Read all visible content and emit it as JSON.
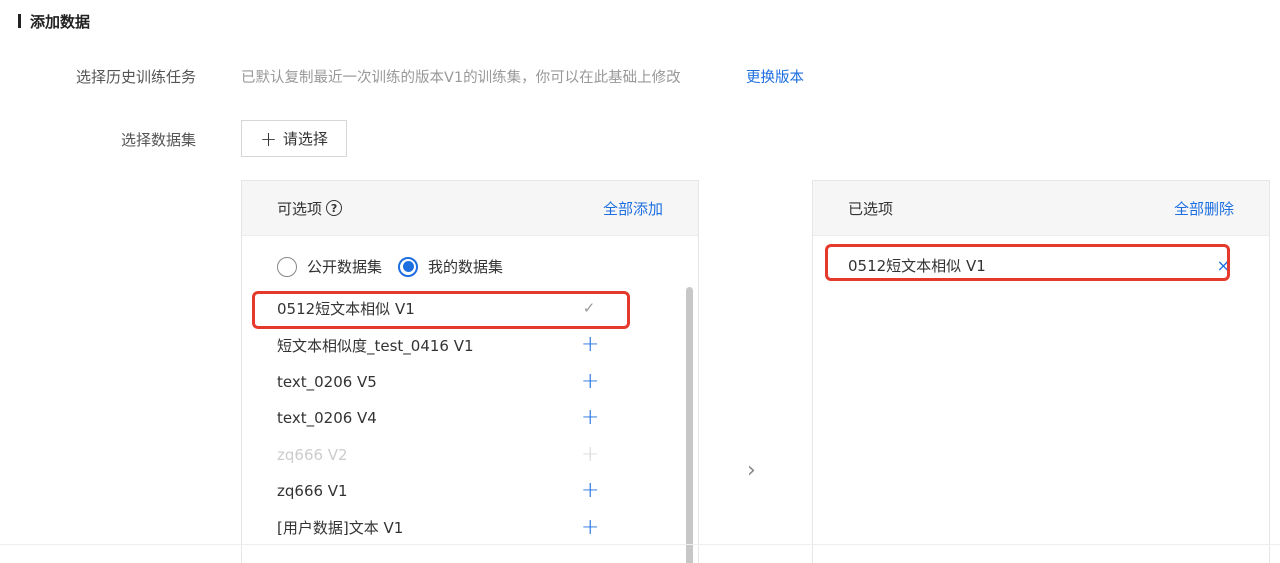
{
  "section": {
    "title": "添加数据"
  },
  "history": {
    "label": "选择历史训练任务",
    "description": "已默认复制最近一次训练的版本V1的训练集，你可以在此基础上修改",
    "link": "更换版本"
  },
  "dataset": {
    "label": "选择数据集",
    "button": "请选择",
    "button_icon": "+"
  },
  "left_panel": {
    "title": "可选项",
    "help_icon": "?",
    "action": "全部添加",
    "radios": [
      {
        "label": "公开数据集",
        "checked": false
      },
      {
        "label": "我的数据集",
        "checked": true
      }
    ],
    "items": [
      {
        "label": "0512短文本相似 V1",
        "state": "selected",
        "mark": "✓"
      },
      {
        "label": "短文本相似度_test_0416 V1",
        "state": "available",
        "mark": "+"
      },
      {
        "label": "text_0206 V5",
        "state": "available",
        "mark": "+"
      },
      {
        "label": "text_0206 V4",
        "state": "available",
        "mark": "+"
      },
      {
        "label": "zq666 V2",
        "state": "disabled",
        "mark": "+"
      },
      {
        "label": "zq666 V1",
        "state": "available",
        "mark": "+"
      },
      {
        "label": "[用户数据]文本 V1",
        "state": "available",
        "mark": "+"
      }
    ]
  },
  "right_panel": {
    "title": "已选项",
    "action": "全部删除",
    "items": [
      {
        "label": "0512短文本相似 V1",
        "remove": "×"
      }
    ]
  },
  "transfer_arrow": "›",
  "colors": {
    "accent": "#1d6fe0",
    "highlight": "#e4392b"
  }
}
